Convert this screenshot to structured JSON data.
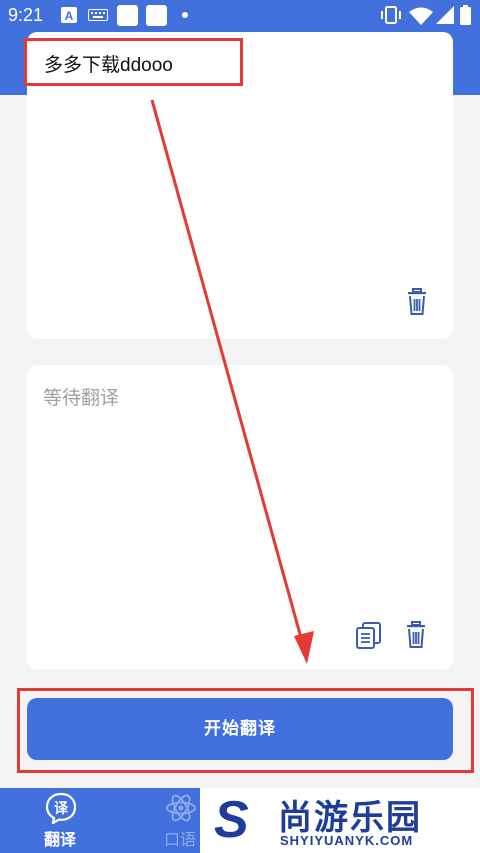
{
  "status_bar": {
    "time": "9:21",
    "icons": [
      "font-a-icon",
      "keyboard-icon",
      "app-square-icon",
      "app-square-icon",
      "dot-icon",
      "vibrate-icon",
      "wifi-icon",
      "signal-icon",
      "battery-icon"
    ]
  },
  "input_card": {
    "text": "多多下载ddooo",
    "clear_icon": "trash-icon"
  },
  "output_card": {
    "placeholder": "等待翻译",
    "copy_icon": "copy-icon",
    "clear_icon": "trash-icon"
  },
  "translate_button": {
    "label": "开始翻译"
  },
  "bottom_nav": {
    "items": [
      {
        "label": "翻译",
        "icon": "translate-icon",
        "active": true
      },
      {
        "label": "口语",
        "icon": "atom-icon",
        "active": false
      }
    ]
  },
  "watermark": {
    "logo_letter": "S",
    "title": "尚游乐园",
    "subtitle": "SHYIYUANYK.COM"
  },
  "colors": {
    "primary": "#4271de",
    "annotation_red": "#e53935",
    "background": "#f4f4f4"
  }
}
